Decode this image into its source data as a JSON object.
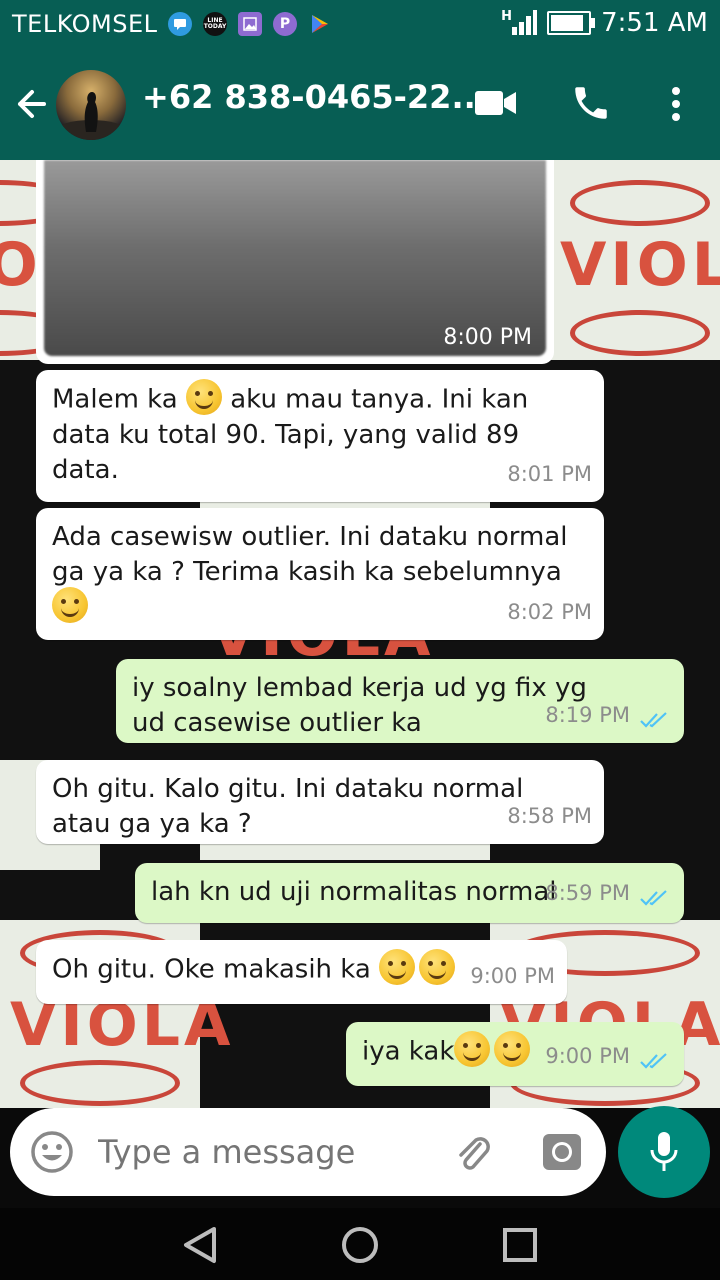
{
  "status_bar": {
    "carrier": "TELKOMSEL",
    "time": "7:51 AM",
    "network_type": "H",
    "notification_icons": [
      "chat-notification-icon",
      "line-today-icon",
      "gallery-icon",
      "p-app-icon",
      "play-store-icon"
    ],
    "notif_line_text": "LINE TODAY",
    "notif_p_text": "P"
  },
  "header": {
    "contact_name": "+62 838-0465-22..."
  },
  "messages": [
    {
      "direction": "in",
      "type": "image",
      "time": "8:00 PM"
    },
    {
      "direction": "in",
      "text_a": "Malem ka ",
      "text_b": " aku mau tanya. Ini kan data ku total 90. Tapi, yang valid 89 data.",
      "time": "8:01 PM"
    },
    {
      "direction": "in",
      "text": "Ada casewisw outlier. Ini dataku normal ga ya ka ? Terima kasih ka sebelumnya ",
      "time": "8:02 PM"
    },
    {
      "direction": "out",
      "text": "iy soalny lembad kerja ud yg fix yg ud casewise outlier ka",
      "time": "8:19 PM",
      "status": "read"
    },
    {
      "direction": "in",
      "text": "Oh gitu. Kalo gitu. Ini dataku normal atau ga ya ka ?",
      "time": "8:58 PM"
    },
    {
      "direction": "out",
      "text": "lah kn ud uji normalitas normal",
      "time": "8:59 PM",
      "status": "read"
    },
    {
      "direction": "in",
      "text": "Oh gitu. Oke makasih ka ",
      "time": "9:00 PM"
    },
    {
      "direction": "out",
      "text": "iya kak",
      "time": "9:00 PM",
      "status": "read"
    }
  ],
  "wallpaper": {
    "watermark": "VIOLA"
  },
  "input": {
    "placeholder": "Type a message"
  },
  "colors": {
    "header": "#075e54",
    "outgoing": "#dcf8c6",
    "incoming": "#ffffff",
    "accent": "#00897b",
    "read_ticks": "#4fc3f7"
  }
}
